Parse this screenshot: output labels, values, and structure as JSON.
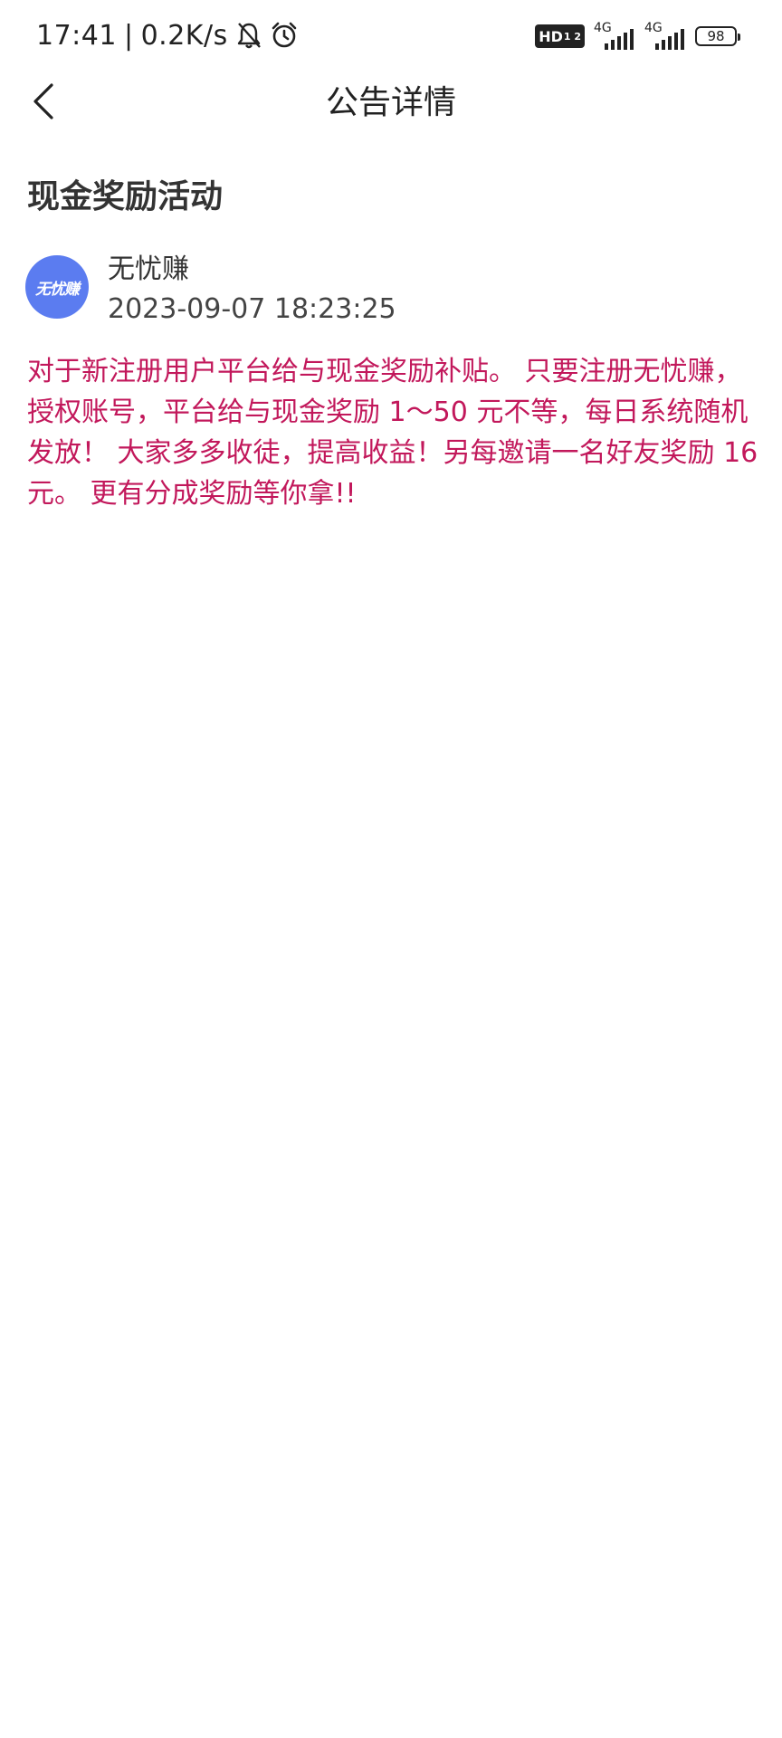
{
  "status_bar": {
    "time": "17:41",
    "separator": "|",
    "net_speed": "0.2K/s",
    "icons": [
      "bell-muted-icon",
      "alarm-icon",
      "hd-voice-icon",
      "signal-4g-icon",
      "signal-4g-icon",
      "battery-icon"
    ],
    "hd_label": "HD",
    "hd_sub": "1 2",
    "sim1_label": "4G",
    "sim2_label": "4G",
    "battery": "98"
  },
  "header": {
    "title": "公告详情",
    "back_icon": "chevron-left-icon"
  },
  "notice": {
    "title": "现金奖励活动",
    "publisher": {
      "avatar_text": "无忧赚",
      "name": "无忧赚",
      "time": "2023-09-07 18:23:25"
    },
    "body": "对于新注册用户平台给与现金奖励补贴。 只要注册无忧赚，授权账号，平台给与现金奖励 1～50 元不等，每日系统随机发放！ 大家多多收徒，提高收益！另每邀请一名好友奖励 16元。 更有分成奖励等你拿!!"
  },
  "colors": {
    "accent_text": "#c2185b",
    "avatar_bg": "#5b7cf0",
    "text_primary": "#222222"
  }
}
